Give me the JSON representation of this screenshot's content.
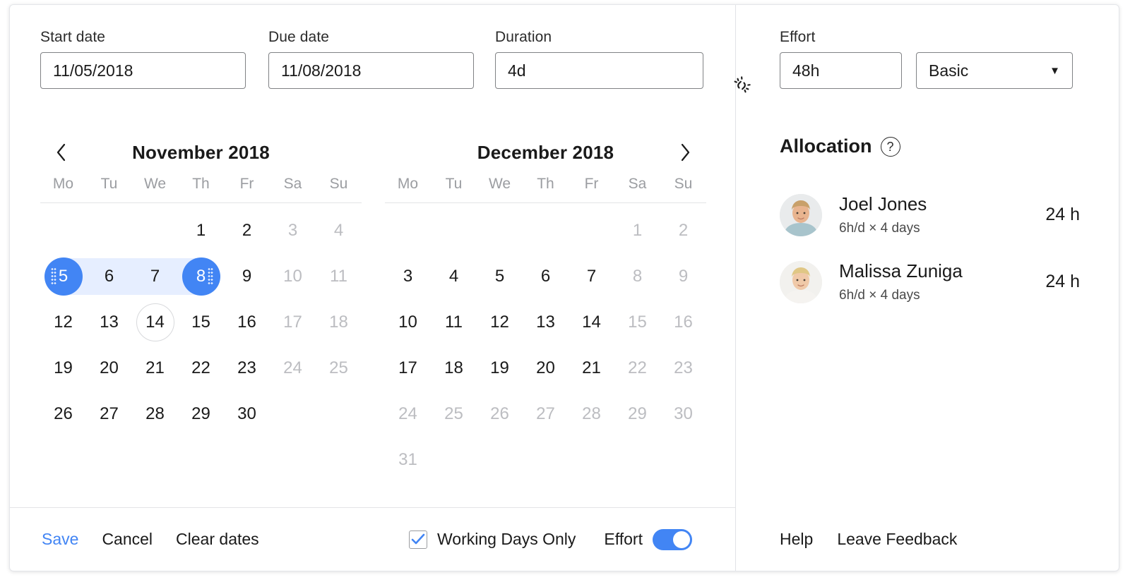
{
  "fields": {
    "start": {
      "label": "Start date",
      "value": "11/05/2018",
      "placeholder": "mm/dd/yyyy"
    },
    "due": {
      "label": "Due date",
      "value": "11/08/2018",
      "placeholder": "mm/dd/yyyy"
    },
    "duration": {
      "label": "Duration",
      "value": "4d",
      "placeholder": "0d"
    },
    "effort": {
      "label": "Effort",
      "value": "48h",
      "placeholder": "0h"
    },
    "effort_type": {
      "value": "Basic",
      "options": [
        "Basic"
      ]
    }
  },
  "icons": {
    "unlink": "unlink-icon",
    "prev": "chevron-left-icon",
    "next": "chevron-right-icon",
    "help": "?",
    "caret": "▼"
  },
  "calendars": [
    {
      "title": "November 2018",
      "dow": [
        "Mo",
        "Tu",
        "We",
        "Th",
        "Fr",
        "Sa",
        "Su"
      ],
      "weeks": [
        [
          {
            "d": "",
            "state": "empty"
          },
          {
            "d": "",
            "state": "empty"
          },
          {
            "d": "",
            "state": "empty"
          },
          {
            "d": "1",
            "state": "normal"
          },
          {
            "d": "2",
            "state": "normal"
          },
          {
            "d": "3",
            "state": "muted"
          },
          {
            "d": "4",
            "state": "muted"
          }
        ],
        [
          {
            "d": "5",
            "state": "selected-start"
          },
          {
            "d": "6",
            "state": "inrange"
          },
          {
            "d": "7",
            "state": "inrange"
          },
          {
            "d": "8",
            "state": "selected-end"
          },
          {
            "d": "9",
            "state": "normal"
          },
          {
            "d": "10",
            "state": "muted"
          },
          {
            "d": "11",
            "state": "muted"
          }
        ],
        [
          {
            "d": "12",
            "state": "normal"
          },
          {
            "d": "13",
            "state": "normal"
          },
          {
            "d": "14",
            "state": "today"
          },
          {
            "d": "15",
            "state": "normal"
          },
          {
            "d": "16",
            "state": "normal"
          },
          {
            "d": "17",
            "state": "muted"
          },
          {
            "d": "18",
            "state": "muted"
          }
        ],
        [
          {
            "d": "19",
            "state": "normal"
          },
          {
            "d": "20",
            "state": "normal"
          },
          {
            "d": "21",
            "state": "normal"
          },
          {
            "d": "22",
            "state": "normal"
          },
          {
            "d": "23",
            "state": "normal"
          },
          {
            "d": "24",
            "state": "muted"
          },
          {
            "d": "25",
            "state": "muted"
          }
        ],
        [
          {
            "d": "26",
            "state": "normal"
          },
          {
            "d": "27",
            "state": "normal"
          },
          {
            "d": "28",
            "state": "normal"
          },
          {
            "d": "29",
            "state": "normal"
          },
          {
            "d": "30",
            "state": "normal"
          },
          {
            "d": "",
            "state": "empty"
          },
          {
            "d": "",
            "state": "empty"
          }
        ]
      ]
    },
    {
      "title": "December 2018",
      "dow": [
        "Mo",
        "Tu",
        "We",
        "Th",
        "Fr",
        "Sa",
        "Su"
      ],
      "weeks": [
        [
          {
            "d": "",
            "state": "empty"
          },
          {
            "d": "",
            "state": "empty"
          },
          {
            "d": "",
            "state": "empty"
          },
          {
            "d": "",
            "state": "empty"
          },
          {
            "d": "",
            "state": "empty"
          },
          {
            "d": "1",
            "state": "muted"
          },
          {
            "d": "2",
            "state": "muted"
          }
        ],
        [
          {
            "d": "3",
            "state": "normal"
          },
          {
            "d": "4",
            "state": "normal"
          },
          {
            "d": "5",
            "state": "normal"
          },
          {
            "d": "6",
            "state": "normal"
          },
          {
            "d": "7",
            "state": "normal"
          },
          {
            "d": "8",
            "state": "muted"
          },
          {
            "d": "9",
            "state": "muted"
          }
        ],
        [
          {
            "d": "10",
            "state": "normal"
          },
          {
            "d": "11",
            "state": "normal"
          },
          {
            "d": "12",
            "state": "normal"
          },
          {
            "d": "13",
            "state": "normal"
          },
          {
            "d": "14",
            "state": "normal"
          },
          {
            "d": "15",
            "state": "muted"
          },
          {
            "d": "16",
            "state": "muted"
          }
        ],
        [
          {
            "d": "17",
            "state": "normal"
          },
          {
            "d": "18",
            "state": "normal"
          },
          {
            "d": "19",
            "state": "normal"
          },
          {
            "d": "20",
            "state": "normal"
          },
          {
            "d": "21",
            "state": "normal"
          },
          {
            "d": "22",
            "state": "muted"
          },
          {
            "d": "23",
            "state": "muted"
          }
        ],
        [
          {
            "d": "24",
            "state": "muted"
          },
          {
            "d": "25",
            "state": "muted"
          },
          {
            "d": "26",
            "state": "muted"
          },
          {
            "d": "27",
            "state": "muted"
          },
          {
            "d": "28",
            "state": "muted"
          },
          {
            "d": "29",
            "state": "muted"
          },
          {
            "d": "30",
            "state": "muted"
          }
        ],
        [
          {
            "d": "31",
            "state": "muted"
          },
          {
            "d": "",
            "state": "empty"
          },
          {
            "d": "",
            "state": "empty"
          },
          {
            "d": "",
            "state": "empty"
          },
          {
            "d": "",
            "state": "empty"
          },
          {
            "d": "",
            "state": "empty"
          },
          {
            "d": "",
            "state": "empty"
          }
        ]
      ]
    }
  ],
  "allocation": {
    "title": "Allocation",
    "rows": [
      {
        "name": "Joel Jones",
        "detail": "6h/d × 4 days",
        "hours": "24 h",
        "avatar": "joel-jones-avatar"
      },
      {
        "name": "Malissa Zuniga",
        "detail": "6h/d × 4 days",
        "hours": "24 h",
        "avatar": "malissa-zuniga-avatar"
      }
    ]
  },
  "footer": {
    "save": "Save",
    "cancel": "Cancel",
    "clear": "Clear dates",
    "working_days_label": "Working Days Only",
    "working_days_checked": true,
    "effort_label": "Effort",
    "effort_toggle_on": true,
    "help": "Help",
    "feedback": "Leave Feedback"
  },
  "colors": {
    "accent": "#4285f4",
    "range_band": "#e6eeff",
    "muted_text": "#bcbdc1",
    "border": "#e3e4e6"
  }
}
